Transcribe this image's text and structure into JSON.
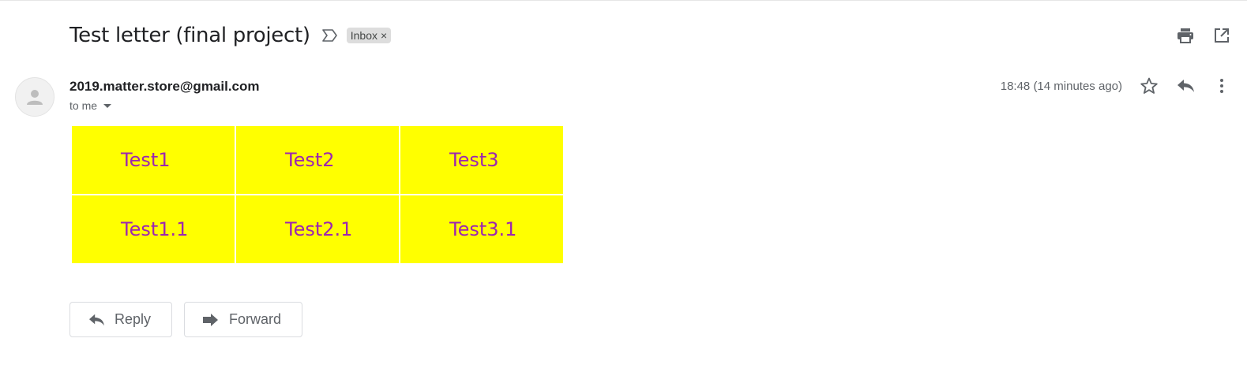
{
  "email": {
    "subject": "Test letter (final project)",
    "label": "Inbox",
    "label_close": "×",
    "sender": "2019.matter.store@gmail.com",
    "recipient": "to me",
    "timestamp": "18:48 (14 minutes ago)"
  },
  "body_table": {
    "rows": [
      [
        "Test1",
        "Test2",
        "Test3"
      ],
      [
        "Test1.1",
        "Test2.1",
        "Test3.1"
      ]
    ],
    "cell_bg": "#ffff00",
    "text_color": "#9c27b0"
  },
  "actions": {
    "reply_label": "Reply",
    "forward_label": "Forward"
  },
  "icons": {
    "important": "important-marker-icon",
    "print": "print-icon",
    "open_new_window": "open-in-new-window-icon",
    "star": "star-icon",
    "reply": "reply-icon",
    "more": "more-vert-icon",
    "avatar": "default-avatar-icon",
    "forward": "forward-icon"
  }
}
